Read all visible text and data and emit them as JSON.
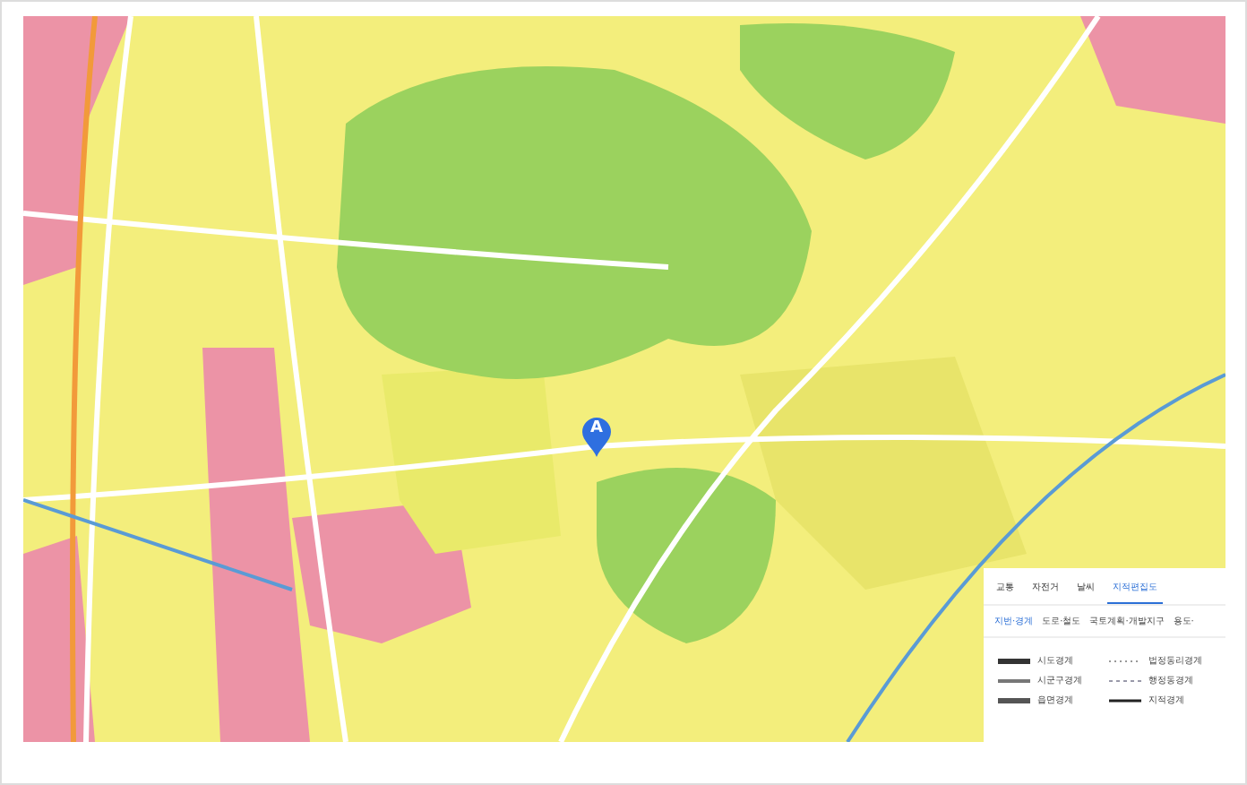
{
  "map": {
    "marker": {
      "label": "A"
    }
  },
  "legend": {
    "tabs": [
      {
        "label": "교통",
        "selected": false
      },
      {
        "label": "자전거",
        "selected": false
      },
      {
        "label": "날씨",
        "selected": false
      },
      {
        "label": "지적편집도",
        "selected": true
      }
    ],
    "subtabs": [
      {
        "label": "지번·경계",
        "selected": true
      },
      {
        "label": "도로·철도",
        "selected": false
      },
      {
        "label": "국토계획·개발지구",
        "selected": false
      },
      {
        "label": "용도·",
        "selected": false
      }
    ],
    "items": [
      {
        "label": "시도경계",
        "kind": "thick"
      },
      {
        "label": "시군구경계",
        "kind": "medium"
      },
      {
        "label": "읍면경계",
        "kind": "bold"
      },
      {
        "label": "법정동리경계",
        "kind": "dotted"
      },
      {
        "label": "행정동경계",
        "kind": "dashed"
      },
      {
        "label": "지적경계",
        "kind": "thin"
      }
    ]
  }
}
